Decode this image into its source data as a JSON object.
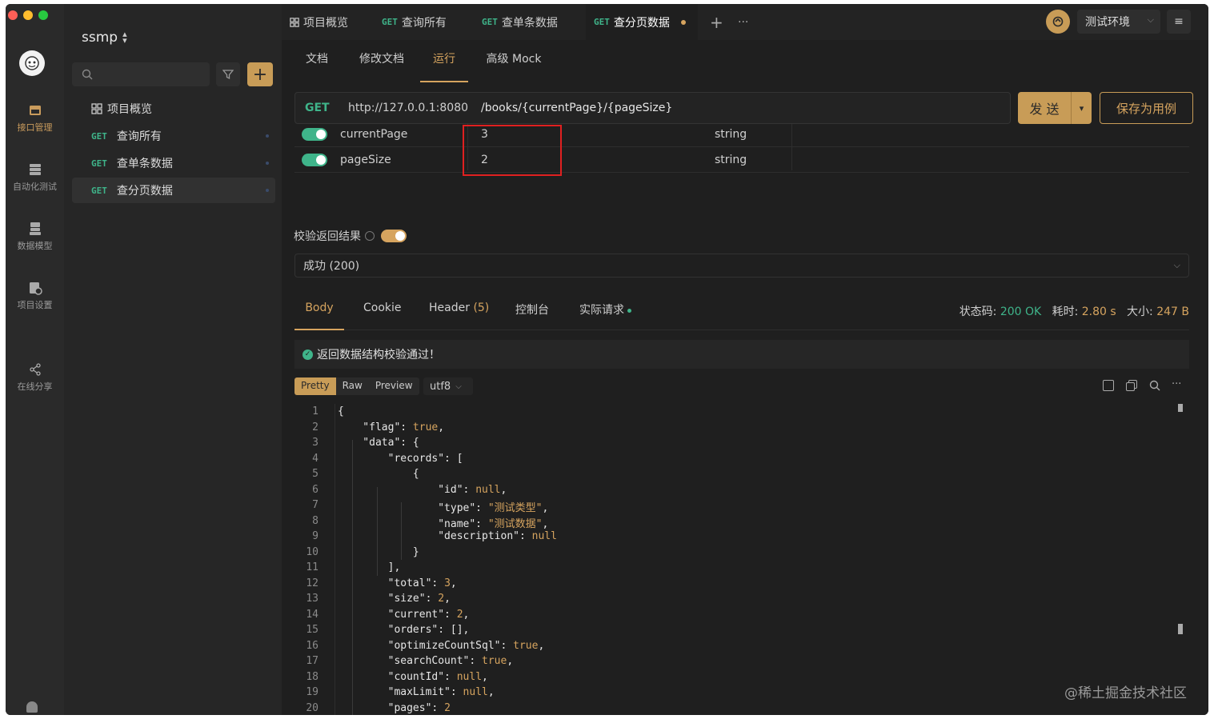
{
  "project": {
    "name": "ssmp",
    "switch_icon": "chevron-updown-icon"
  },
  "rail": {
    "items": [
      {
        "label": "接口管理",
        "icon": "api-icon"
      },
      {
        "label": "自动化测试",
        "icon": "automation-icon"
      },
      {
        "label": "数据模型",
        "icon": "data-model-icon"
      },
      {
        "label": "项目设置",
        "icon": "settings-icon"
      },
      {
        "label": "在线分享",
        "icon": "share-icon"
      }
    ]
  },
  "sidebar": {
    "search_placeholder": "",
    "tree": [
      {
        "method": "",
        "label": "项目概览"
      },
      {
        "method": "GET",
        "label": "查询所有"
      },
      {
        "method": "GET",
        "label": "查单条数据"
      },
      {
        "method": "GET",
        "label": "查分页数据"
      }
    ]
  },
  "tabs": [
    {
      "method": "",
      "label": "项目概览"
    },
    {
      "method": "GET",
      "label": "查询所有"
    },
    {
      "method": "GET",
      "label": "查单条数据"
    },
    {
      "method": "GET",
      "label": "查分页数据"
    }
  ],
  "tab_add": "+",
  "tab_more": "···",
  "env": {
    "label": "测试环境"
  },
  "subtabs": [
    "文档",
    "修改文档",
    "运行",
    "高级 Mock"
  ],
  "request": {
    "method": "GET",
    "base": "http://127.0.0.1:8080",
    "path": "/books/{currentPage}/{pageSize}",
    "send_label": "发 送",
    "save_label": "保存为用例"
  },
  "params": [
    {
      "name": "currentPage",
      "value": "3",
      "type": "string"
    },
    {
      "name": "pageSize",
      "value": "2",
      "type": "string"
    }
  ],
  "validate": {
    "label": "校验返回结果",
    "response": "成功 (200)"
  },
  "response_tabs": {
    "body": "Body",
    "cookie": "Cookie",
    "header": "Header",
    "header_count": "(5)",
    "console": "控制台",
    "actual": "实际请求"
  },
  "status": {
    "code_label": "状态码:",
    "code": "200 OK",
    "time_label": "耗时:",
    "time": "2.80 s",
    "size_label": "大小:",
    "size": "247 B"
  },
  "validation_message": "返回数据结构校验通过！",
  "view_modes": [
    "Pretty",
    "Raw",
    "Preview"
  ],
  "encoding": "utf8",
  "code_lines": [
    "{",
    "    \"flag\": true,",
    "    \"data\": {",
    "        \"records\": [",
    "            {",
    "                \"id\": null,",
    "                \"type\": \"测试类型\",",
    "                \"name\": \"测试数据\",",
    "                \"description\": null",
    "            }",
    "        ],",
    "        \"total\": 3,",
    "        \"size\": 2,",
    "        \"current\": 2,",
    "        \"orders\": [],",
    "        \"optimizeCountSql\": true,",
    "        \"searchCount\": true,",
    "        \"countId\": null,",
    "        \"maxLimit\": null,",
    "        \"pages\": 2"
  ],
  "watermark": "@稀土掘金技术社区",
  "colors": {
    "accent": "#d6a45f",
    "method_get": "#3fb48a",
    "highlight_box": "#e02020"
  }
}
